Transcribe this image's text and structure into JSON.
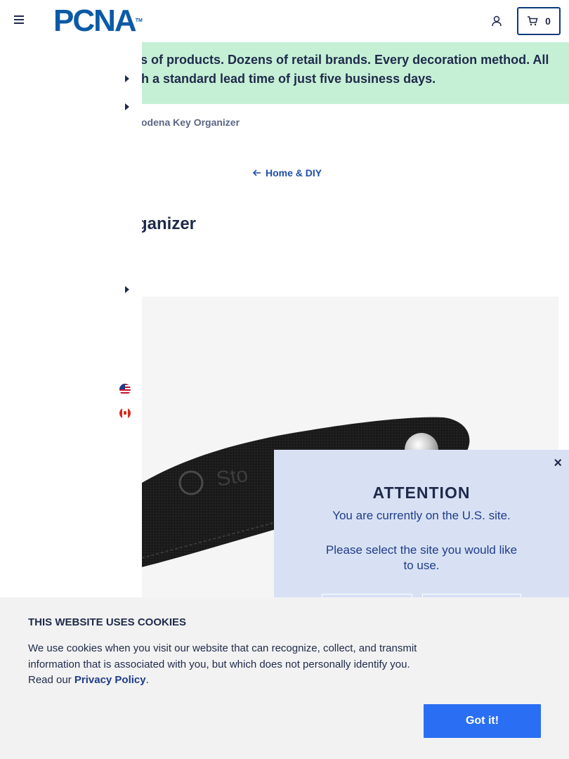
{
  "header": {
    "logo_text": "PCNA",
    "logo_tm": "TM",
    "cart_count": "0"
  },
  "banner": {
    "line1": "ls of products. Dozens of retail brands. Every decoration method. All",
    "line2": "th a standard lead time of just five business days."
  },
  "breadcrumb": {
    "current": "odena Key Organizer"
  },
  "back_link": {
    "label": "Home & DIY"
  },
  "product": {
    "title": "ganizer",
    "image_brand_text": "Sto"
  },
  "attention_modal": {
    "close_label": "×",
    "heading": "ATTENTION",
    "message1": "You are currently on the U.S. site.",
    "message2": "Please select the site you would like to use."
  },
  "cookie_banner": {
    "heading": "THIS WEBSITE USES COOKIES",
    "body": "We use cookies when you visit our website that can recognize, collect, and transmit information that is associated with you, but which does not personally identify you. Read our ",
    "link": "Privacy Policy",
    "suffix": ".",
    "button": "Got it!"
  },
  "colors": {
    "brand_blue": "#0b5aa6",
    "banner_green": "#c6f0d6",
    "modal_bg": "#d8e1f4",
    "button_blue": "#2a6ff3"
  },
  "icons": [
    "hamburger-icon",
    "user-icon",
    "cart-icon",
    "caret-right-icon",
    "arrow-left-icon",
    "us-flag-icon",
    "canada-flag-icon",
    "close-icon"
  ]
}
